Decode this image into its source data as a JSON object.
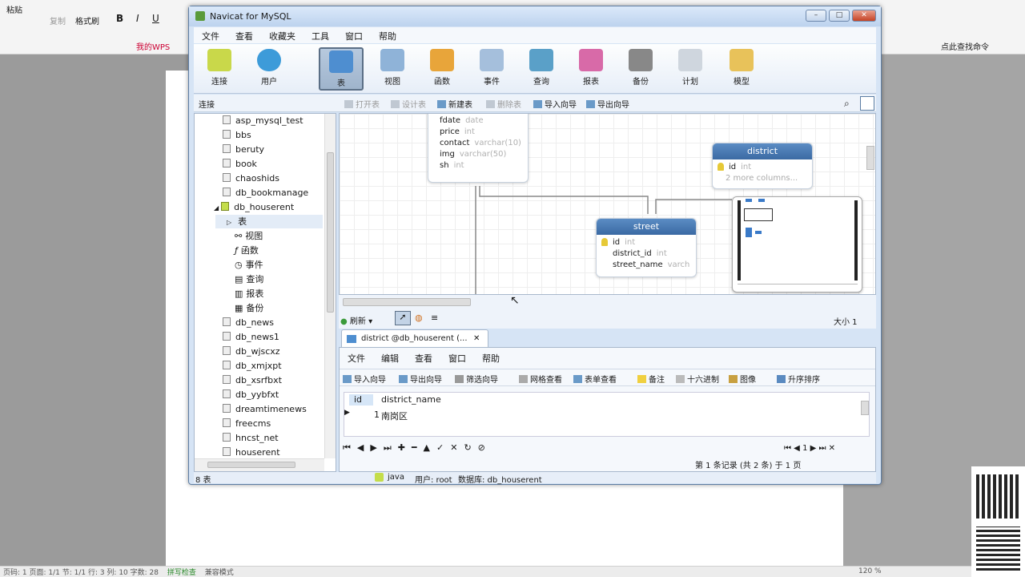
{
  "wps": {
    "format_painter": "格式刷",
    "paste": "粘贴",
    "copy": "复制",
    "wps_online": "我的WPS",
    "search_label": "点此查找命令",
    "status_pages": "页码: 1  页面: 1/1  节: 1/1  行: 3  列: 10  字数: 28",
    "spell_check": "拼写检查",
    "compat_mode": "兼容模式",
    "zoom": "120 %"
  },
  "window": {
    "title": "Navicat for MySQL"
  },
  "menu": [
    "文件",
    "查看",
    "收藏夹",
    "工具",
    "窗口",
    "帮助"
  ],
  "toolbar": [
    "连接",
    "用户",
    "表",
    "视图",
    "函数",
    "事件",
    "查询",
    "报表",
    "备份",
    "计划",
    "模型"
  ],
  "subbar": {
    "conn_label": "连接",
    "buttons": [
      "打开表",
      "设计表",
      "新建表",
      "删除表",
      "导入向导",
      "导出向导"
    ]
  },
  "sidebar": {
    "databases_top": [
      "asp_mysql_test",
      "bbs",
      "beruty",
      "book",
      "chaoshids",
      "db_bookmanage",
      "db_houserent"
    ],
    "children": [
      "表",
      "视图",
      "函数",
      "事件",
      "查询",
      "报表",
      "备份"
    ],
    "databases_bottom": [
      "db_news",
      "db_news1",
      "db_wjscxz",
      "db_xmjxpt",
      "db_xsrfbxt",
      "db_yybfxt",
      "dreamtimenews",
      "freecms",
      "hncst_net",
      "houserent"
    ]
  },
  "diagram": {
    "house_fields": [
      [
        "fdate",
        "date"
      ],
      [
        "price",
        "int"
      ],
      [
        "contact",
        "varchar(10)"
      ],
      [
        "img",
        "varchar(50)"
      ],
      [
        "sh",
        "int"
      ]
    ],
    "district": {
      "name": "district",
      "fields": [
        [
          "id",
          "int"
        ]
      ],
      "more": "2 more columns..."
    },
    "street": {
      "name": "street",
      "fields": [
        [
          "id",
          "int"
        ],
        [
          "district_id",
          "int"
        ],
        [
          "street_name",
          "varch"
        ]
      ]
    },
    "refresh": "刷新",
    "size": "大小 1"
  },
  "data_tab": {
    "title": "district @db_houserent (...",
    "menu": [
      "文件",
      "编辑",
      "查看",
      "窗口",
      "帮助"
    ],
    "toolbar": [
      "导入向导",
      "导出向导",
      "筛选向导",
      "网格查看",
      "表单查看",
      "备注",
      "十六进制",
      "图像",
      "升序排序"
    ],
    "columns": [
      "id",
      "district_name"
    ],
    "rows": [
      [
        "1",
        "南岗区"
      ]
    ],
    "page_label": "1",
    "record_info": "第 1 条记录 (共 2 条) 于 1 页"
  },
  "status": {
    "count": "8 表",
    "conn": "java",
    "user": "用户: root",
    "db": "数据库: db_houserent"
  }
}
